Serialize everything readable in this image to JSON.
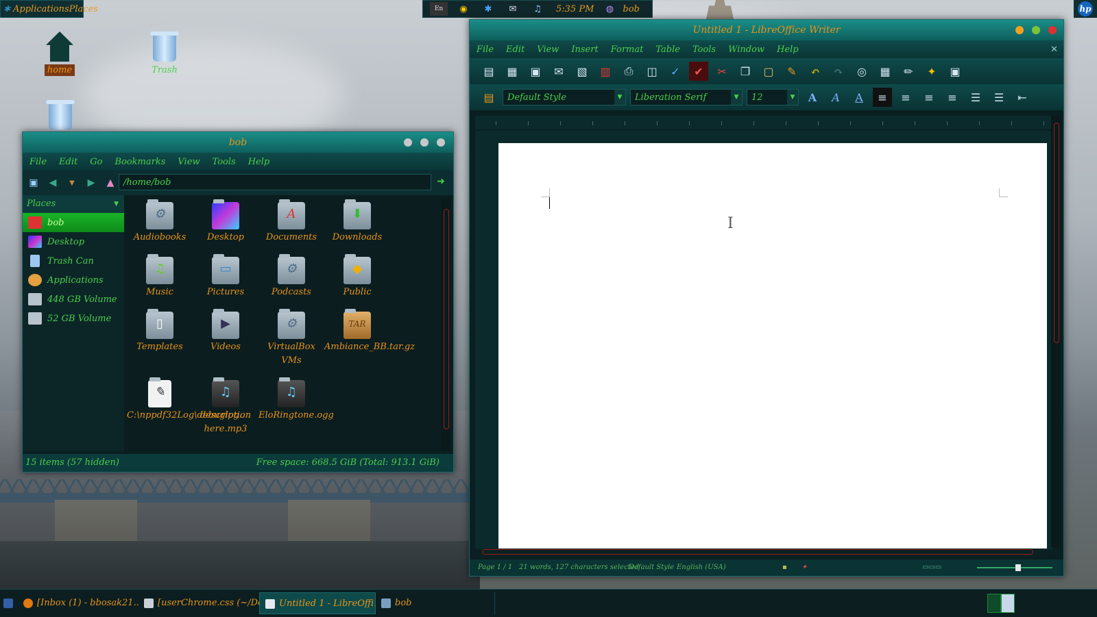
{
  "top_panel": {
    "app_menu_label": "ApplicationsPlaces",
    "tray_keyboard_label": "En",
    "clock": "5:35 PM",
    "user": "bob",
    "brand": "hp"
  },
  "desktop": {
    "icons": [
      {
        "label": "home"
      },
      {
        "label": "Trash"
      }
    ]
  },
  "file_manager": {
    "title": "bob",
    "menu": [
      "File",
      "Edit",
      "Go",
      "Bookmarks",
      "View",
      "Tools",
      "Help"
    ],
    "location": "/home/bob",
    "sidebar_header": "Places",
    "places": [
      "bob",
      "Desktop",
      "Trash Can",
      "Applications",
      "448 GB Volume",
      "52 GB Volume"
    ],
    "items": [
      {
        "label": "Audiobooks",
        "icon": "folder-gear-icon"
      },
      {
        "label": "Desktop",
        "icon": "desktop-folder-icon"
      },
      {
        "label": "Documents",
        "icon": "documents-folder-icon"
      },
      {
        "label": "Downloads",
        "icon": "downloads-folder-icon"
      },
      {
        "label": "Music",
        "icon": "music-folder-icon"
      },
      {
        "label": "Pictures",
        "icon": "pictures-folder-icon"
      },
      {
        "label": "Podcasts",
        "icon": "folder-gear-icon"
      },
      {
        "label": "Public",
        "icon": "public-folder-icon"
      },
      {
        "label": "Templates",
        "icon": "templates-folder-icon"
      },
      {
        "label": "Videos",
        "icon": "videos-folder-icon"
      },
      {
        "label": "VirtualBox VMs",
        "icon": "folder-gear-icon"
      },
      {
        "label": "Ambiance_BB.tar.gz",
        "icon": "archive-icon"
      },
      {
        "label": "C:\\nppdf32Log\\debuglog....",
        "icon": "text-file-icon"
      },
      {
        "label": "description here.mp3",
        "icon": "mpeg-audio-icon"
      },
      {
        "label": "EloRingtone.ogg",
        "icon": "ogg-audio-icon"
      }
    ],
    "status_left": "15 items (57 hidden)",
    "status_right": "Free space: 668.5 GiB (Total: 913.1 GiB)"
  },
  "writer": {
    "title": "Untitled 1 - LibreOffice Writer",
    "menu": [
      "File",
      "Edit",
      "View",
      "Insert",
      "Format",
      "Table",
      "Tools",
      "Window",
      "Help"
    ],
    "paragraph_style": "Default Style",
    "font_name": "Liberation Serif",
    "font_size": "12",
    "status": {
      "page": "Page 1 / 1",
      "words": "21 words, 127 characters selected",
      "style": "Default Style",
      "language": "English (USA)"
    }
  },
  "taskbar": {
    "tasks": [
      {
        "label": "[Inbox (1) - bbosak21...",
        "active": false
      },
      {
        "label": "[userChrome.css (~/Do...",
        "active": false
      },
      {
        "label": "Untitled 1 - LibreOffi...",
        "active": true
      },
      {
        "label": "bob",
        "active": false
      }
    ]
  },
  "colors": {
    "accent_orange": "#e8951a",
    "accent_green": "#4bd04b",
    "teal": "#0f4a4a"
  }
}
